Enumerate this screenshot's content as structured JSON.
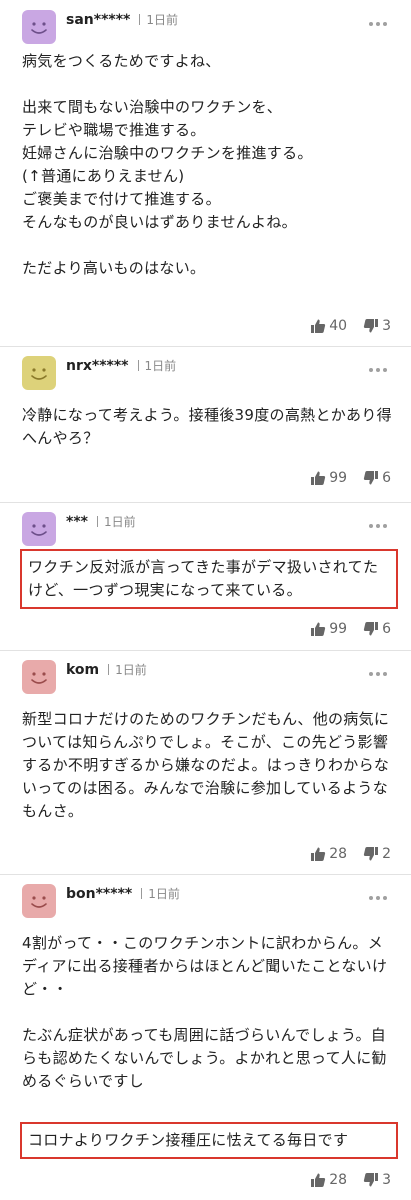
{
  "comments": [
    {
      "username": "san*****",
      "time": "1日前",
      "avatar_color": "#c9a7e3",
      "text": "病気をつくるためですよね、\n\n出来て間もない治験中のワクチンを、\nテレビや職場で推進する。\n妊婦さんに治験中のワクチンを推進する。\n(↑普通にありえません)\nご褒美まで付けて推進する。\nそんなものが良いはずありませんよね。\n\nただより高いものはない。",
      "highlight": "",
      "likes": "40",
      "dislikes": "3"
    },
    {
      "username": "nrx*****",
      "time": "1日前",
      "avatar_color": "#ddd27a",
      "text": "冷静になって考えよう。接種後39度の高熱とかあり得へんやろ？",
      "highlight": "",
      "likes": "99",
      "dislikes": "6"
    },
    {
      "username": "***",
      "time": "1日前",
      "avatar_color": "#c9a7e3",
      "text": "",
      "highlight": "ワクチン反対派が言ってきた事がデマ扱いされてたけど、一つずつ現実になって来ている。",
      "likes": "99",
      "dislikes": "6"
    },
    {
      "username": "kom",
      "time": "1日前",
      "avatar_color": "#e8aaaa",
      "text": "新型コロナだけのためのワクチンだもん、他の病気については知らんぷりでしょ。そこが、この先どう影響するか不明すぎるから嫌なのだよ。はっきりわからないってのは困る。みんなで治験に参加しているようなもんさ。",
      "highlight": "",
      "likes": "28",
      "dislikes": "2"
    },
    {
      "username": "bon*****",
      "time": "1日前",
      "avatar_color": "#e8aaaa",
      "text": "4割がって・・このワクチンホントに訳わからん。メディアに出る接種者からはほとんど聞いたことないけど・・\n\nたぶん症状があっても周囲に話づらいんでしょう。自らも認めたくないんでしょう。よかれと思って人に勧めるぐらいですし",
      "highlight": "コロナよりワクチン接種圧に怯えてる毎日です",
      "likes": "28",
      "dislikes": "3"
    }
  ]
}
